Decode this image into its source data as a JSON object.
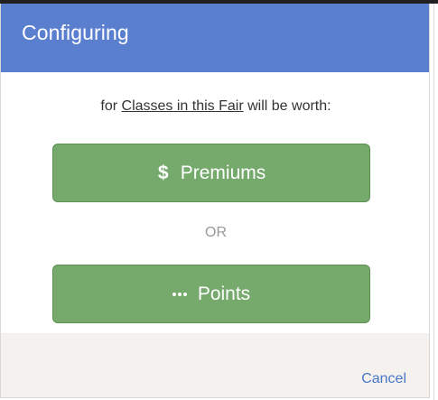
{
  "dialog": {
    "title": "Configuring",
    "prompt_prefix": "for ",
    "prompt_link": "Classes in this Fair",
    "prompt_suffix": " will be worth:",
    "or_text": "OR",
    "cancel_label": "Cancel"
  },
  "choices": {
    "premiums": {
      "icon": "dollar-icon",
      "icon_text": "$",
      "label": "Premiums"
    },
    "points": {
      "icon": "dots-icon",
      "label": "Points"
    }
  },
  "colors": {
    "header": "#5b7fcf",
    "button": "#76a96c",
    "footer": "#f4f1ee",
    "link": "#4a78c9"
  }
}
